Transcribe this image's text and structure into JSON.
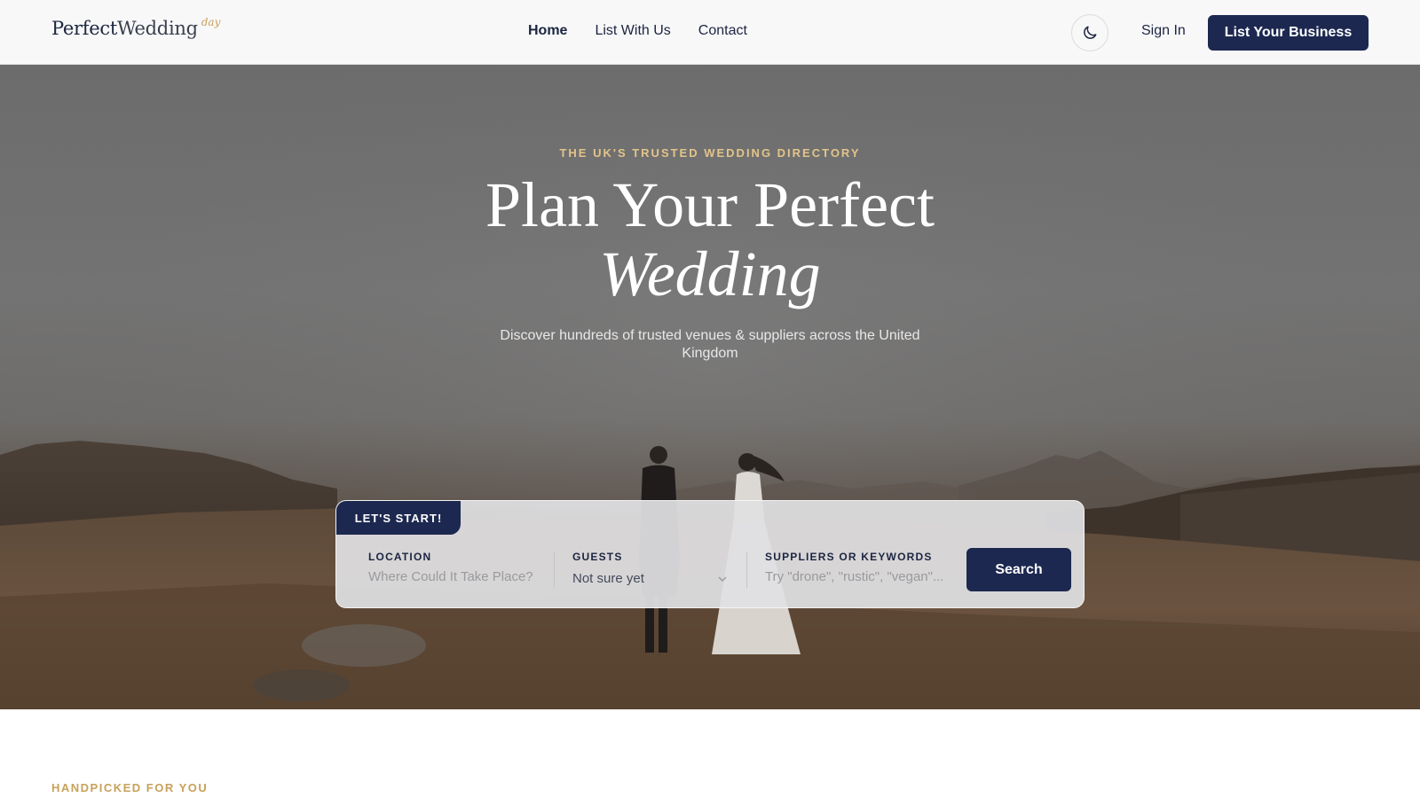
{
  "logo": {
    "part1": "Perfect",
    "part2": "Wedding",
    "part3": "day"
  },
  "nav": {
    "items": [
      "Home",
      "List With Us",
      "Contact"
    ]
  },
  "header": {
    "theme_icon": "moon-icon",
    "signin_label": "Sign In",
    "cta_label": "List Your Business"
  },
  "hero": {
    "eyebrow": "THE UK'S TRUSTED WEDDING DIRECTORY",
    "title_line1": "Plan Your Perfect",
    "title_line2": "Wedding",
    "subtitle": "Discover hundreds of trusted venues & suppliers across the United Kingdom"
  },
  "search": {
    "tab_label": "LET'S START!",
    "location": {
      "label": "LOCATION",
      "placeholder": "Where Could It Take Place?"
    },
    "guests": {
      "label": "GUESTS",
      "value": "Not sure yet"
    },
    "keywords": {
      "label": "SUPPLIERS OR KEYWORDS",
      "placeholder": "Try \"drone\", \"rustic\", \"vegan\"..."
    },
    "button_label": "Search"
  },
  "section": {
    "eyebrow": "HANDPICKED FOR YOU"
  },
  "colors": {
    "navy": "#1c2850",
    "gold": "#c8a15a",
    "hero_gold": "#e3c48a"
  }
}
